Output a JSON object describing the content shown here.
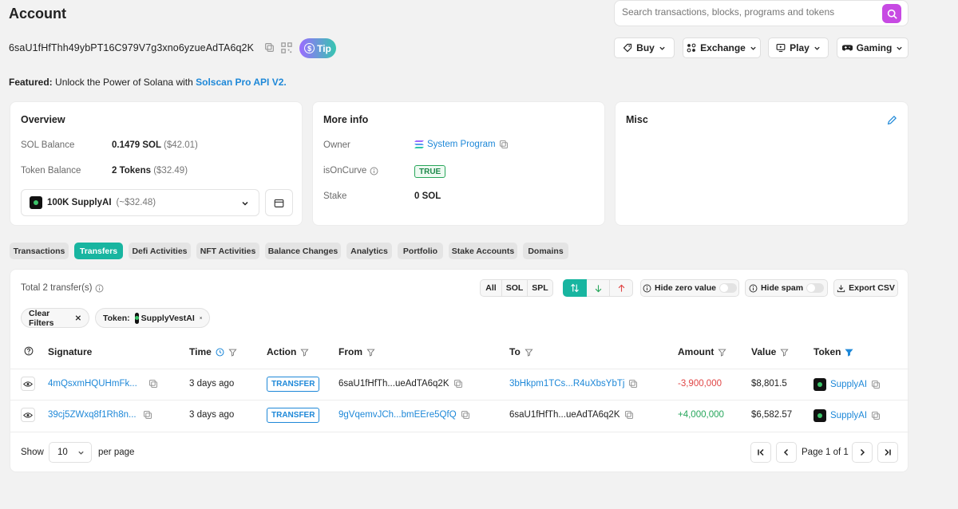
{
  "header": {
    "title": "Account",
    "search_placeholder": "Search transactions, blocks, programs and tokens",
    "address": "6saU1fHfThh49ybPT16C979V7g3xno6yzueAdTA6q2K",
    "tip_label": "Tip",
    "menus": [
      {
        "label": "Buy"
      },
      {
        "label": "Exchange"
      },
      {
        "label": "Play"
      },
      {
        "label": "Gaming"
      }
    ]
  },
  "featured": {
    "prefix": "Featured:",
    "text": " Unlock the Power of Solana with ",
    "link": "Solscan Pro API V2."
  },
  "overview": {
    "title": "Overview",
    "sol_balance_label": "SOL Balance",
    "sol_balance_value": "0.1479 SOL",
    "sol_balance_usd": "($42.01)",
    "token_balance_label": "Token Balance",
    "token_balance_value": "2 Tokens",
    "token_balance_usd": "($32.49)",
    "selected_token": "100K SupplyAI",
    "selected_token_usd": "(~$32.48)"
  },
  "more_info": {
    "title": "More info",
    "owner_label": "Owner",
    "owner_value": "System Program",
    "oncurve_label": "isOnCurve",
    "oncurve_value": "TRUE",
    "stake_label": "Stake",
    "stake_value": "0 SOL"
  },
  "misc": {
    "title": "Misc"
  },
  "tabs": [
    {
      "label": "Transactions",
      "active": false
    },
    {
      "label": "Transfers",
      "active": true
    },
    {
      "label": "Defi Activities",
      "active": false
    },
    {
      "label": "NFT Activities",
      "active": false
    },
    {
      "label": "Balance Changes",
      "active": false
    },
    {
      "label": "Analytics",
      "active": false
    },
    {
      "label": "Portfolio",
      "active": false
    },
    {
      "label": "Stake Accounts",
      "active": false
    },
    {
      "label": "Domains",
      "active": false
    }
  ],
  "transfers": {
    "total_label": "Total 2 transfer(s)",
    "type_filters": [
      "All",
      "SOL",
      "SPL"
    ],
    "hide_zero_label": "Hide zero value",
    "hide_spam_label": "Hide spam",
    "export_label": "Export CSV",
    "clear_filters_label": "Clear Filters",
    "token_filter_prefix": "Token:",
    "token_filter_value": "SupplyVestAI",
    "columns": [
      "Signature",
      "Time",
      "Action",
      "From",
      "To",
      "Amount",
      "Value",
      "Token"
    ],
    "rows": [
      {
        "signature": "4mQsxmHQUHmFk...",
        "time": "3 days ago",
        "action": "TRANSFER",
        "from": "6saU1fHfTh...ueAdTA6q2K",
        "to": "3bHkpm1TCs...R4uXbsYbTj",
        "amount": "-3,900,000",
        "value": "$8,801.5",
        "token": "SupplyAI"
      },
      {
        "signature": "39cj5ZWxq8f1Rh8n...",
        "time": "3 days ago",
        "action": "TRANSFER",
        "from": "9gVqemvJCh...bmEEre5QfQ",
        "to": "6saU1fHfTh...ueAdTA6q2K",
        "amount": "+4,000,000",
        "value": "$6,582.57",
        "token": "SupplyAI"
      }
    ],
    "show_label": "Show",
    "per_page_value": "10",
    "per_page_label": "per page",
    "page_label": "Page 1 of 1"
  },
  "colors": {
    "accent": "#18b5a0",
    "link": "#1e88d8",
    "search_btn": "#c74ae3",
    "negative": "#e04545",
    "positive": "#26a65b"
  }
}
